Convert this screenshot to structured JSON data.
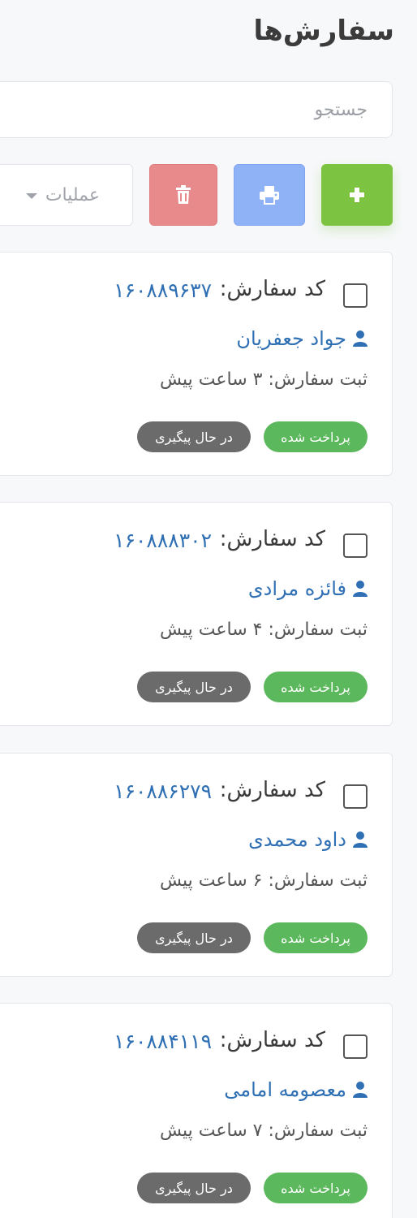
{
  "header": {
    "title": "سفارش‌ها"
  },
  "search": {
    "placeholder": "جستجو"
  },
  "toolbar": {
    "add_icon": "plus-icon",
    "print_icon": "print-icon",
    "delete_icon": "trash-icon",
    "operations_label": "عملیات"
  },
  "colors": {
    "add": "#7cc342",
    "print": "#8fb2f6",
    "delete": "#e88a8b",
    "paid": "#5cb85c",
    "tracking": "#6b6b6b",
    "link": "#2f6fb3"
  },
  "orders": [
    {
      "code_label": "کد سفارش:",
      "code": "۱۶۰۸۸۹۶۳۷",
      "customer": "جواد جعفریان",
      "time": "ثبت سفارش: ۳ ساعت پیش",
      "payment": "پرداخت شده",
      "status": "در حال پیگیری"
    },
    {
      "code_label": "کد سفارش:",
      "code": "۱۶۰۸۸۸۳۰۲",
      "customer": "فائزه مرادی",
      "time": "ثبت سفارش: ۴ ساعت پیش",
      "payment": "پرداخت شده",
      "status": "در حال پیگیری"
    },
    {
      "code_label": "کد سفارش:",
      "code": "۱۶۰۸۸۶۲۷۹",
      "customer": "داود محمدی",
      "time": "ثبت سفارش: ۶ ساعت پیش",
      "payment": "پرداخت شده",
      "status": "در حال پیگیری"
    },
    {
      "code_label": "کد سفارش:",
      "code": "۱۶۰۸۸۴۱۱۹",
      "customer": "معصومه امامی",
      "time": "ثبت سفارش: ۷ ساعت پیش",
      "payment": "پرداخت شده",
      "status": "در حال پیگیری"
    }
  ]
}
